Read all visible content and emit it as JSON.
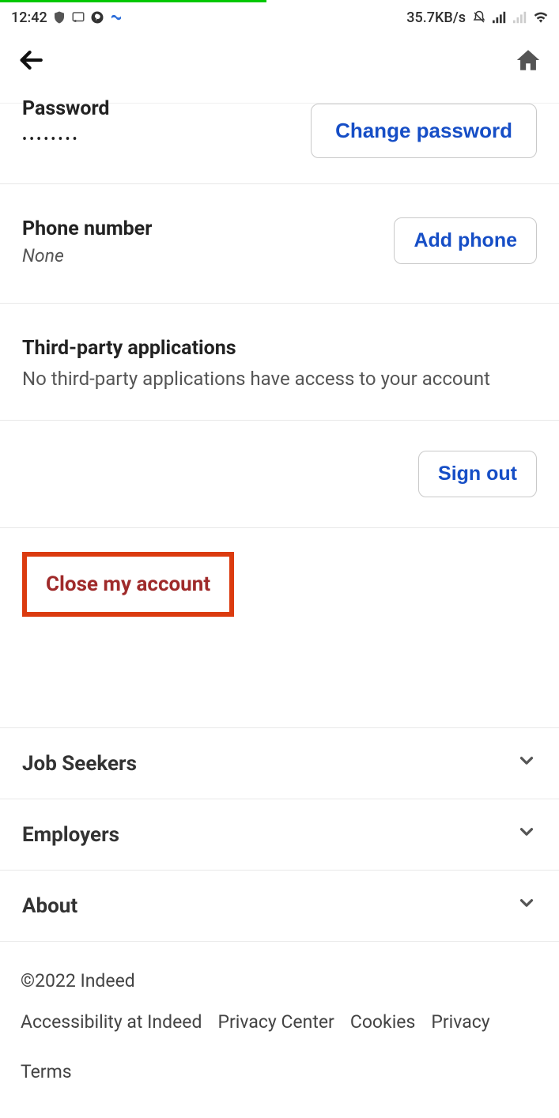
{
  "status": {
    "time": "12:42",
    "data_rate": "35.7KB/s"
  },
  "account": {
    "password": {
      "label": "Password",
      "masked": "••••••••",
      "button": "Change password"
    },
    "phone": {
      "label": "Phone number",
      "value": "None",
      "button": "Add phone"
    },
    "third_party": {
      "label": "Third-party applications",
      "description": "No third-party applications have access to your account"
    },
    "signout": "Sign out",
    "close": "Close my account"
  },
  "footer_sections": [
    {
      "label": "Job Seekers"
    },
    {
      "label": "Employers"
    },
    {
      "label": "About"
    }
  ],
  "footer": {
    "copyright": "©2022 Indeed",
    "links": [
      "Accessibility at Indeed",
      "Privacy Center",
      "Cookies",
      "Privacy",
      "Terms"
    ]
  }
}
